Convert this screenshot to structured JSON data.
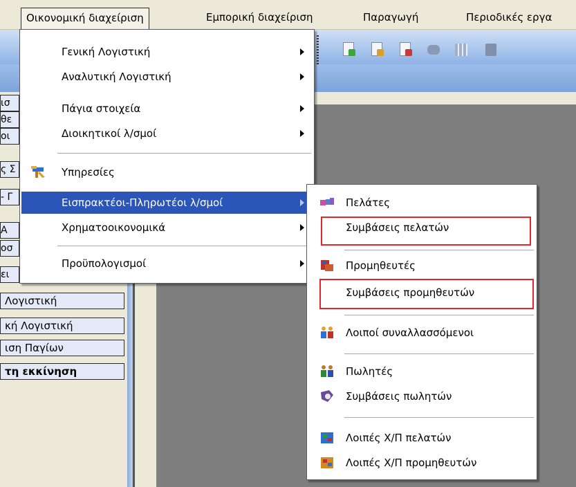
{
  "menubar": {
    "items": [
      {
        "label": "Οικονομική διαχείριση",
        "active": true
      },
      {
        "label": "Εμπορική διαχείριση"
      },
      {
        "label": "Παραγωγή"
      },
      {
        "label": "Περιοδικές εργα"
      }
    ]
  },
  "left_panel": {
    "stubs": [
      "ισ",
      "θε",
      "οι",
      "ς Σ",
      "- Γ",
      "Α",
      "οσ",
      "ει"
    ],
    "rows": [
      {
        "label": "Λογιστική"
      },
      {
        "label": "κή Λογιστική"
      },
      {
        "label": "ιση Παγίων"
      },
      {
        "label": "τη εκκίνηση",
        "bold": true
      }
    ]
  },
  "main_menu": {
    "items": [
      {
        "label": "Γενική Λογιστική",
        "submenu": true
      },
      {
        "label": "Αναλυτική Λογιστική",
        "submenu": true
      },
      {
        "label": "Πάγια στοιχεία",
        "submenu": true
      },
      {
        "label": "Διοικητικοί λ/σμοί",
        "submenu": true
      },
      {
        "label": "Υπηρεσίες",
        "icon": "services-icon"
      },
      {
        "label": "Εισπρακτέοι-Πληρωτέοι λ/σμοί",
        "submenu": true,
        "highlighted": true
      },
      {
        "label": "Χρηματοοικονομικά",
        "submenu": true
      },
      {
        "label": "Προϋπολογισμοί",
        "submenu": true
      }
    ]
  },
  "sub_menu": {
    "items": [
      {
        "label": "Πελάτες",
        "icon": "customers-icon"
      },
      {
        "label": "Συμβάσεις πελατών",
        "boxed": true
      },
      {
        "label": "Προμηθευτές",
        "icon": "suppliers-icon"
      },
      {
        "label": "Συμβάσεις προμηθευτών",
        "boxed": true
      },
      {
        "label": "Λοιποί συναλλασσόμενοι",
        "icon": "other-partners-icon"
      },
      {
        "label": "Πωλητές",
        "icon": "salesmen-icon"
      },
      {
        "label": "Συμβάσεις πωλητών",
        "icon": "salesmen-contracts-icon"
      },
      {
        "label": "Λοιπές Χ/Π πελατών",
        "icon": "customers-other-dc-icon"
      },
      {
        "label": "Λοιπές Χ/Π προμηθευτών",
        "icon": "suppliers-other-dc-icon"
      }
    ]
  },
  "colors": {
    "highlight": "#2c55b8",
    "annotation": "#e0262b",
    "toolbar": "#8fb3e6"
  }
}
